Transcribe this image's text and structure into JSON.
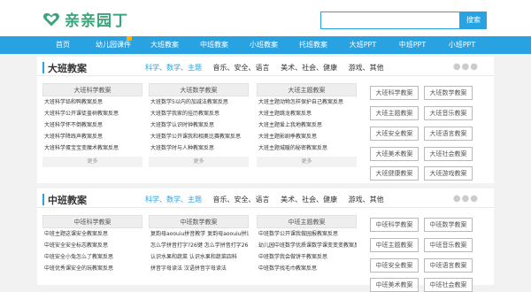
{
  "site": {
    "title": "亲亲园丁",
    "brand_color": "#3aa57a",
    "accent": "#29a2e2"
  },
  "search": {
    "placeholder": "",
    "button": "搜索"
  },
  "nav": [
    {
      "label": "首页",
      "hot": false
    },
    {
      "label": "幼儿园课件",
      "hot": true
    },
    {
      "label": "大班教案",
      "hot": false
    },
    {
      "label": "中班教案",
      "hot": false
    },
    {
      "label": "小班教案",
      "hot": false
    },
    {
      "label": "托班教案",
      "hot": false
    },
    {
      "label": "大班PPT",
      "hot": false
    },
    {
      "label": "中班PPT",
      "hot": false
    },
    {
      "label": "小班PPT",
      "hot": false
    }
  ],
  "sections": [
    {
      "title": "大班教案",
      "tabs": [
        "科学、数学、主题",
        "音乐、安全、语言",
        "美术、社会、健康",
        "游戏、其他"
      ],
      "more": "●●●",
      "columns": [
        {
          "heading": "大班科学教案",
          "items": [
            "大班科学铅和鸭教案反思",
            "大班科学公开课徒盖树教案反思",
            "大班科学怀不倒教案反思",
            "大班科学降践声教案反思",
            "大班科学蛋宝宝变魔术教案反思"
          ],
          "more": "更多"
        },
        {
          "heading": "大班数学教案",
          "items": [
            "大班数学5以内的加减法教案反思",
            "大班数学我家的挂历教案反思",
            "大班数学认识时钟教案反思",
            "大班数学公开课我和相奥比赛教案反思",
            "大班数学时与人种教案反思"
          ],
          "more": "更多"
        },
        {
          "heading": "大班主题教案",
          "items": [
            "大班主题动物怎样保护自己教案反思",
            "大班主题跳龙教案反思",
            "大班主题爱上我地教案反思",
            "大班主题影剧季教案反思",
            "大班主题城暖的秘密教案反思"
          ],
          "more": "更多"
        }
      ],
      "tags": [
        "大班科学教案",
        "大班数学教案",
        "大班主题教案",
        "大班音乐教案",
        "大班安全教案",
        "大班语言教案",
        "大班美术教案",
        "大班社会教案",
        "大班健康教案",
        "大班游戏教案"
      ]
    },
    {
      "title": "中班教案",
      "tabs": [
        "科学、数学、主题",
        "音乐、安全、语言",
        "美术、社会、健康",
        "游戏、其他"
      ],
      "more": "●●●",
      "columns": [
        {
          "heading": "中班科学教案",
          "items": [
            "中班主题这课安全教案反思",
            "中班安全安全标志教案反思",
            "中班安全小兔怎么了教案反思",
            "中班优秀课安全的玩教案反思"
          ],
          "more": "更多"
        },
        {
          "heading": "中班数学教案",
          "items": [
            "复韵母aoouiu拼音教学 复韵母aoouiu拼读",
            "怎么学拼音打字?26键 怎么学拼音打字26",
            "认识水果和蔬菜 认识水果和蔬菜四科",
            "拼音字母读法 汉语拼音字母读法"
          ],
          "more": "更多"
        },
        {
          "heading": "中班主题教案",
          "items": [
            "中班数学公开课我做园报教案反思",
            "幼儿园中班数学优质课数学课变变变教案反思",
            "中班数学我会做饼干教案反思",
            "中班数学找毛巾教案反思"
          ],
          "more": "更多"
        }
      ],
      "tags": [
        "中班科学教案",
        "中班数学教案",
        "中班主题教案",
        "中班音乐教案",
        "中班安全教案",
        "中班语言教案",
        "中班美术教案",
        "中班社会教案"
      ]
    }
  ]
}
